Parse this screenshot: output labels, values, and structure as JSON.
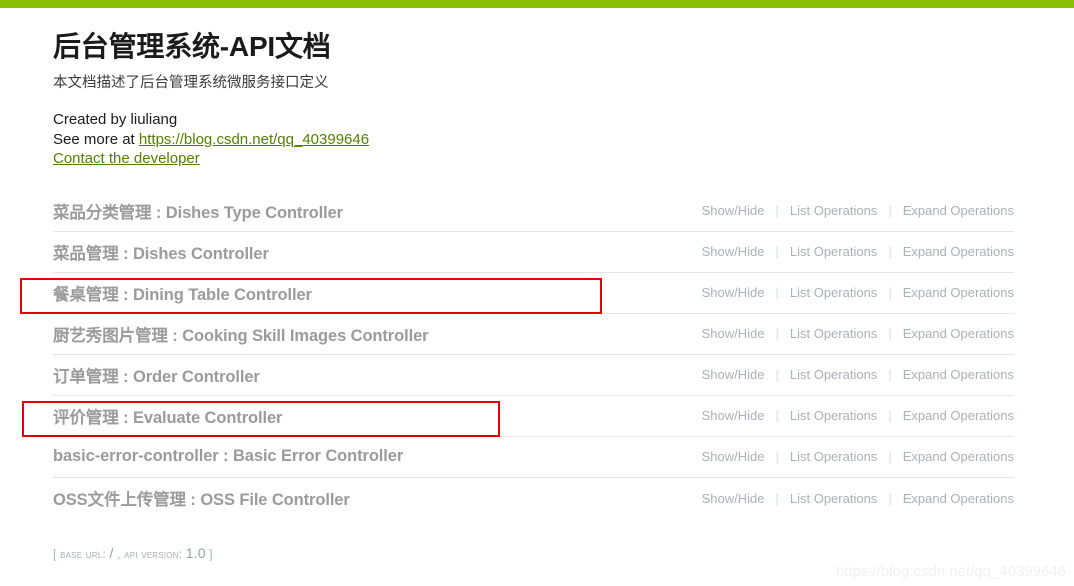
{
  "top_bar": {
    "color": "#89bf04"
  },
  "info": {
    "title": "后台管理系统-API文档",
    "description": "本文档描述了后台管理系统微服务接口定义",
    "created_by": "Created by liuliang",
    "see_more_prefix": "See more at ",
    "see_more_link": "https://blog.csdn.net/qq_40399646",
    "contact_link": "Contact the developer"
  },
  "operations_labels": {
    "show_hide": "Show/Hide",
    "list_operations": "List Operations",
    "expand_operations": "Expand Operations",
    "divider": "|"
  },
  "resources": [
    {
      "zh": "菜品分类管理",
      "sep": " : ",
      "en": "Dishes Type Controller",
      "highlighted": false
    },
    {
      "zh": "菜品管理",
      "sep": " : ",
      "en": "Dishes Controller",
      "highlighted": false
    },
    {
      "zh": "餐桌管理",
      "sep": " : ",
      "en": "Dining Table Controller",
      "highlighted": true
    },
    {
      "zh": "厨艺秀图片管理",
      "sep": " : ",
      "en": "Cooking Skill Images Controller",
      "highlighted": false
    },
    {
      "zh": "订单管理",
      "sep": " : ",
      "en": "Order Controller",
      "highlighted": false
    },
    {
      "zh": "评价管理",
      "sep": " : ",
      "en": "Evaluate Controller",
      "highlighted": true
    },
    {
      "zh": "basic-error-controller",
      "sep": " : ",
      "en": "Basic Error Controller",
      "highlighted": false
    },
    {
      "zh": "OSS文件上传管理",
      "sep": " : ",
      "en": "OSS File Controller",
      "highlighted": false
    }
  ],
  "footer": {
    "open_bracket": "[",
    "base_url_label": "base url",
    "colon_1": ": ",
    "base_url_value": "/",
    "comma": " , ",
    "api_version_label": "api version",
    "colon_2": ": ",
    "api_version_value": "1.0",
    "close_bracket": "]"
  },
  "watermark": {
    "text": "https://blog.csdn.net/qq_40399646"
  },
  "annotations": {
    "box_color": "#e60000",
    "box_1_target": "餐桌管理 : Dining Table Controller",
    "box_2_target": "评价管理 : Evaluate Controller"
  }
}
